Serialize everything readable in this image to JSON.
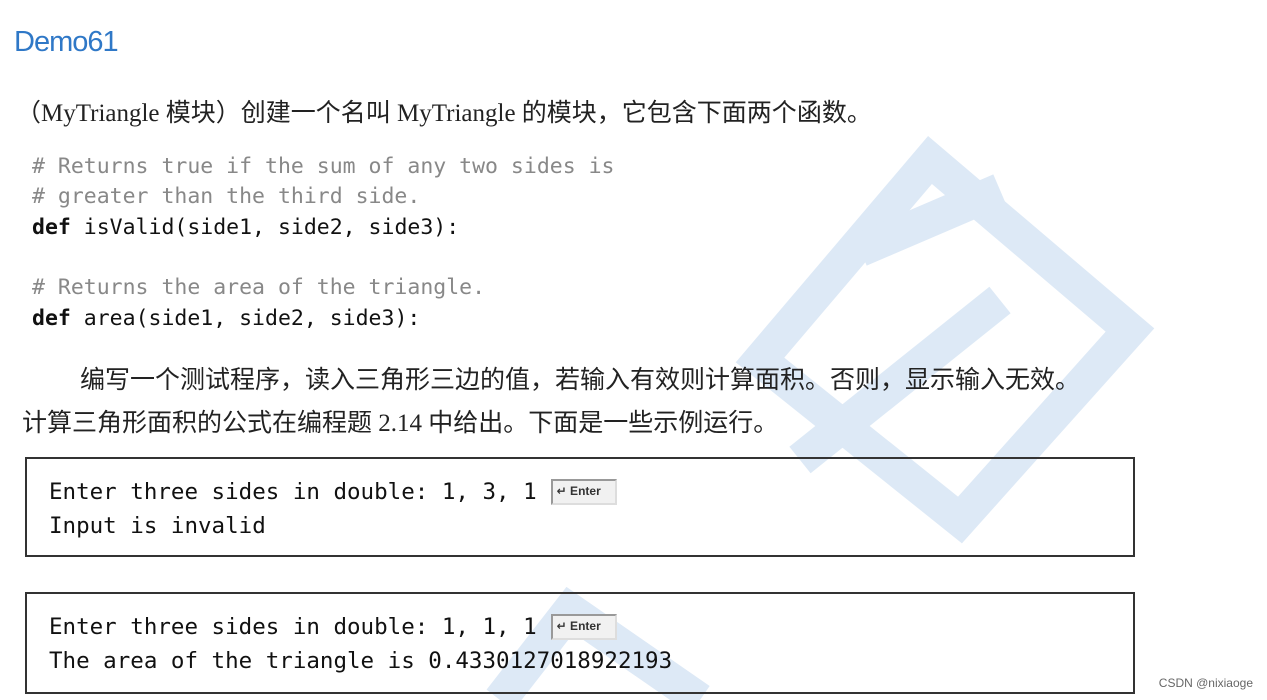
{
  "title": "Demo61",
  "intro": "（MyTriangle 模块）创建一个名叫 MyTriangle 的模块，它包含下面两个函数。",
  "code": {
    "comment1a": "# Returns true if the sum of any two sides is",
    "comment1b": "#  greater than the third side.",
    "def1_kw": "def",
    "def1_rest": " isValid(side1, side2, side3):",
    "comment2": "# Returns the area of the triangle.",
    "def2_kw": "def",
    "def2_rest": " area(side1, side2, side3):"
  },
  "description": {
    "line1": "编写一个测试程序，读入三角形三边的值，若输入有效则计算面积。否则，显示输入无效。",
    "line2": "计算三角形面积的公式在编程题 2.14 中给出。下面是一些示例运行。"
  },
  "sample_runs": [
    {
      "input_line": "Enter three sides in double: 1, 3, 1",
      "enter_key": "↵ Enter",
      "output_line": "Input is invalid"
    },
    {
      "input_line": "Enter three sides in double: 1, 1, 1",
      "enter_key": "↵ Enter",
      "output_line": "The area of the triangle is 0.4330127018922193"
    }
  ],
  "watermark_color": "#d6e6f5",
  "footer": "CSDN @nixiaoge"
}
